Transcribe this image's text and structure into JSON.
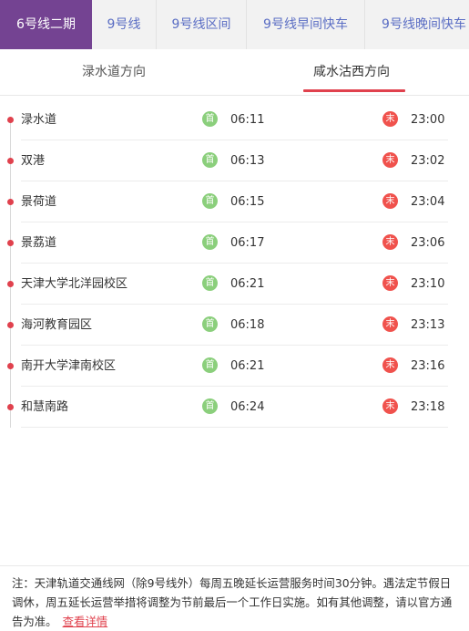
{
  "line_tabs": [
    {
      "label": "6号线二期"
    },
    {
      "label": "9号线"
    },
    {
      "label": "9号线区间"
    },
    {
      "label": "9号线早间快车"
    },
    {
      "label": "9号线晚间快车"
    }
  ],
  "active_line_tab": "6号线二期",
  "direction_tabs": [
    {
      "label": "渌水道方向"
    },
    {
      "label": "咸水沽西方向"
    }
  ],
  "active_direction": "咸水沽西方向",
  "badges": {
    "first": "首",
    "last": "末"
  },
  "stations": [
    {
      "name": "渌水道",
      "first": "06:11",
      "last": "23:00"
    },
    {
      "name": "双港",
      "first": "06:13",
      "last": "23:02"
    },
    {
      "name": "景荷道",
      "first": "06:15",
      "last": "23:04"
    },
    {
      "name": "景荔道",
      "first": "06:17",
      "last": "23:06"
    },
    {
      "name": "天津大学北洋园校区",
      "first": "06:21",
      "last": "23:10"
    },
    {
      "name": "海河教育园区",
      "first": "06:18",
      "last": "23:13"
    },
    {
      "name": "南开大学津南校区",
      "first": "06:21",
      "last": "23:16"
    },
    {
      "name": "和慧南路",
      "first": "06:24",
      "last": "23:18"
    }
  ],
  "note": {
    "text": "注：天津轨道交通线网（除9号线外）每周五晚延长运营服务时间30分钟。遇法定节假日调休，周五延长运营举措将调整为节前最后一个工作日实施。如有其他调整，请以官方通告为准。",
    "link": "查看详情"
  },
  "colors": {
    "active_tab": "#744392",
    "tab_text": "#5b6ec4",
    "accent": "#e0414d",
    "first_badge": "#8bcf7c",
    "last_badge": "#f0524d"
  }
}
